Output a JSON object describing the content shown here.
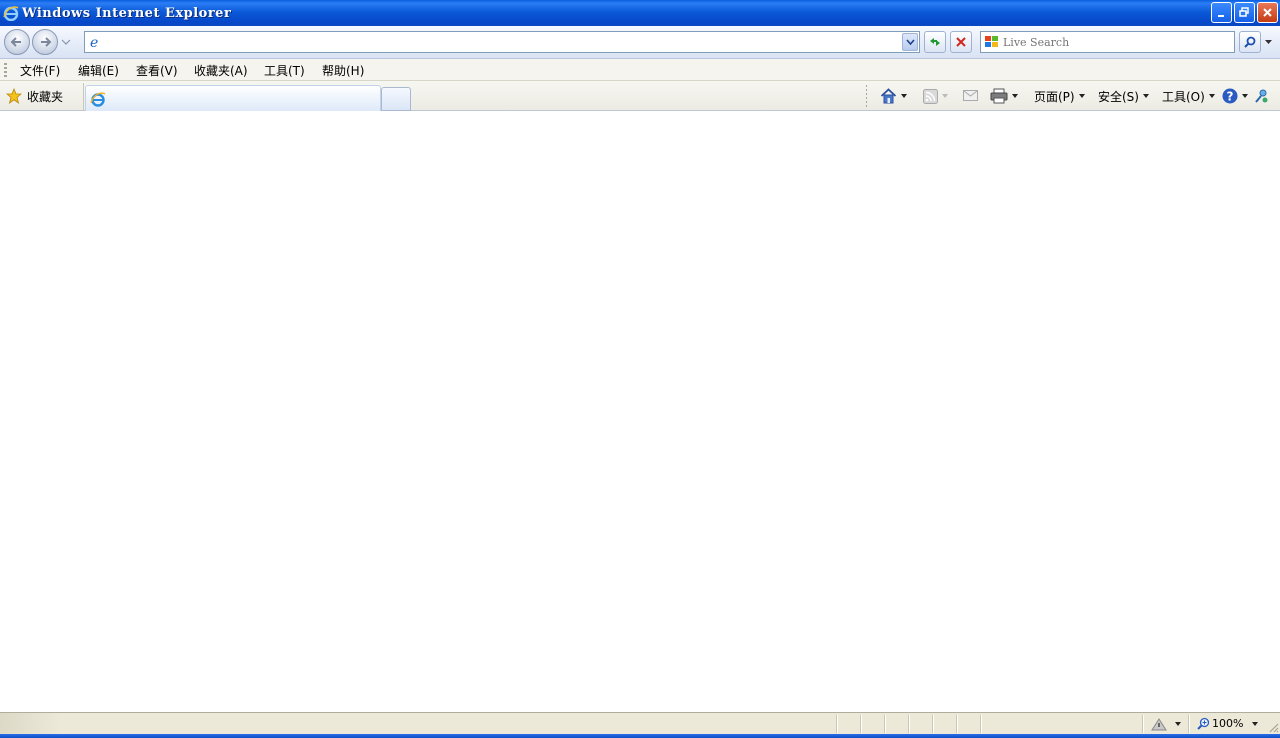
{
  "window": {
    "title": "Windows Internet Explorer"
  },
  "address_bar": {
    "url": "",
    "placeholder": ""
  },
  "search": {
    "placeholder": "Live Search"
  },
  "menu": {
    "items": [
      {
        "label": "文件(F)"
      },
      {
        "label": "编辑(E)"
      },
      {
        "label": "查看(V)"
      },
      {
        "label": "收藏夹(A)"
      },
      {
        "label": "工具(T)"
      },
      {
        "label": "帮助(H)"
      }
    ]
  },
  "favorites": {
    "label": "收藏夹"
  },
  "tabs": [
    {
      "title": "",
      "active": true
    }
  ],
  "command_bar": {
    "page_label": "页面(P)",
    "safety_label": "安全(S)",
    "tools_label": "工具(O)"
  },
  "status": {
    "zoom": "100%"
  },
  "colors": {
    "titlebar": "#0a5fe0",
    "chrome": "#ece9d8",
    "close": "#c43c12"
  }
}
